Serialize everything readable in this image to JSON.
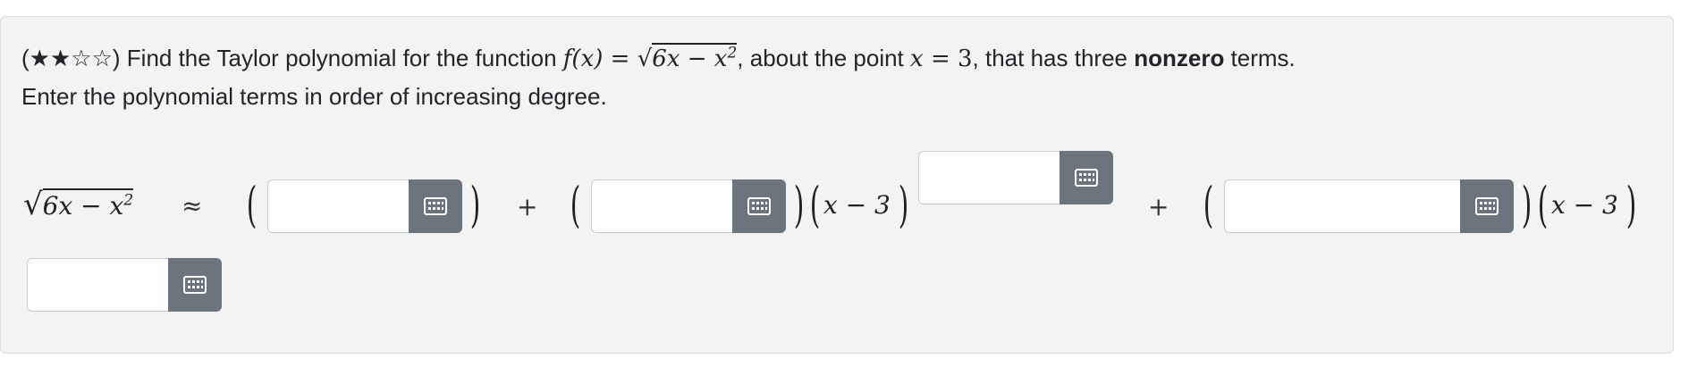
{
  "question": {
    "difficulty_stars": "(★★☆☆)",
    "text_part1": " Find the Taylor polynomial for the function ",
    "func_name": "f(x)",
    "equals": " = ",
    "func_sqrt_body": "6x − x",
    "exp2": "2",
    "text_part2": ", about the point ",
    "point_var": "x",
    "point_eq": " = 3",
    "text_part3": ", that has three ",
    "bold_word": "nonzero",
    "text_part4": " terms.",
    "line2": "Enter the polynomial terms in order of increasing degree."
  },
  "expression": {
    "lhs_body": "6x − x",
    "lhs_exp": "2",
    "approx": "≈",
    "plus": "+",
    "factor": "x − 3",
    "open_paren": "(",
    "close_paren": ")"
  },
  "inputs": {
    "coef0": {
      "value": "",
      "placeholder": ""
    },
    "coef1": {
      "value": "",
      "placeholder": ""
    },
    "exp1": {
      "value": "",
      "placeholder": ""
    },
    "coef2": {
      "value": "",
      "placeholder": ""
    },
    "exp2": {
      "value": "",
      "placeholder": ""
    }
  },
  "icons": {
    "keyboard_button": "keyboard-grid-icon"
  },
  "colors": {
    "button_bg": "#6c757d",
    "card_bg": "#f3f3f3"
  }
}
